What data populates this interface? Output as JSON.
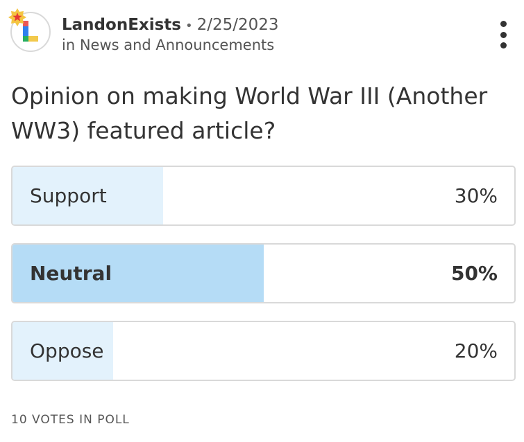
{
  "post": {
    "author": "LandonExists",
    "separator": "•",
    "date": "2/25/2023",
    "community": "in News and Announcements",
    "avatar_letter": "L",
    "badge_icon": "star-badge-icon",
    "menu_icon": "more-vertical-icon"
  },
  "poll": {
    "question": "Opinion on making World War III (Another WW3) featured article?",
    "options": [
      {
        "label": "Support",
        "percent_text": "30%",
        "fill_fraction": 0.3,
        "selected": false
      },
      {
        "label": "Neutral",
        "percent_text": "50%",
        "fill_fraction": 0.5,
        "selected": true
      },
      {
        "label": "Oppose",
        "percent_text": "20%",
        "fill_fraction": 0.2,
        "selected": false
      }
    ],
    "votes_text": "10 VOTES IN POLL"
  },
  "colors": {
    "fill_default": "#e3f2fc",
    "fill_selected": "#b5dcf6",
    "border": "#d9d9d9",
    "badge": "#f4c542",
    "star": "#e53935"
  }
}
